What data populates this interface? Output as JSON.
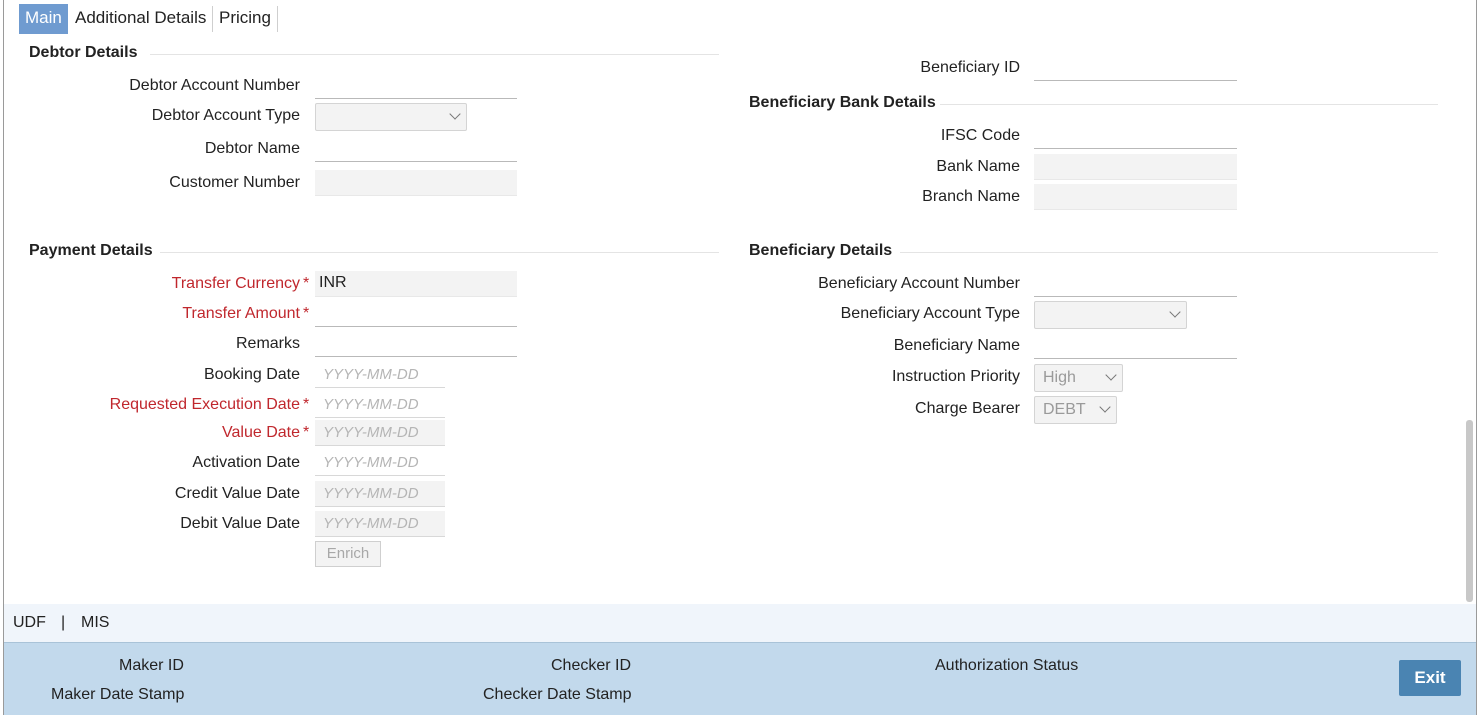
{
  "tabs": [
    {
      "label": "Main",
      "active": true
    },
    {
      "label": "Additional Details",
      "active": false
    },
    {
      "label": "Pricing",
      "active": false
    }
  ],
  "debtor": {
    "title": "Debtor Details",
    "account_number_label": "Debtor Account Number",
    "account_type_label": "Debtor Account Type",
    "name_label": "Debtor Name",
    "customer_number_label": "Customer Number"
  },
  "beneficiary_id": {
    "label": "Beneficiary ID"
  },
  "bank": {
    "title": "Beneficiary Bank Details",
    "ifsc_label": "IFSC Code",
    "bank_name_label": "Bank Name",
    "branch_name_label": "Branch Name"
  },
  "payment": {
    "title": "Payment Details",
    "transfer_currency_label": "Transfer Currency",
    "transfer_currency_value": "INR",
    "transfer_amount_label": "Transfer Amount",
    "remarks_label": "Remarks",
    "booking_date_label": "Booking Date",
    "requested_execution_date_label": "Requested Execution Date",
    "value_date_label": "Value Date",
    "activation_date_label": "Activation Date",
    "credit_value_date_label": "Credit Value Date",
    "debit_value_date_label": "Debit Value Date",
    "date_placeholder": "YYYY-MM-DD",
    "required_marker": "*",
    "enrich_label": "Enrich"
  },
  "beneficiary": {
    "title": "Beneficiary Details",
    "account_number_label": "Beneficiary Account Number",
    "account_type_label": "Beneficiary Account Type",
    "name_label": "Beneficiary Name",
    "instruction_priority_label": "Instruction Priority",
    "instruction_priority_value": "High",
    "charge_bearer_label": "Charge Bearer",
    "charge_bearer_value": "DEBT"
  },
  "subnav": {
    "udf": "UDF",
    "separator": "|",
    "mis": "MIS"
  },
  "footer": {
    "maker_id": "Maker ID",
    "maker_date_stamp": "Maker Date Stamp",
    "checker_id": "Checker ID",
    "checker_date_stamp": "Checker Date Stamp",
    "authorization_status": "Authorization Status",
    "exit_label": "Exit"
  },
  "colors": {
    "accent": "#6f9bd0",
    "required": "#c0272d",
    "footer": "#c2d9ec",
    "exit": "#4a84b2"
  }
}
